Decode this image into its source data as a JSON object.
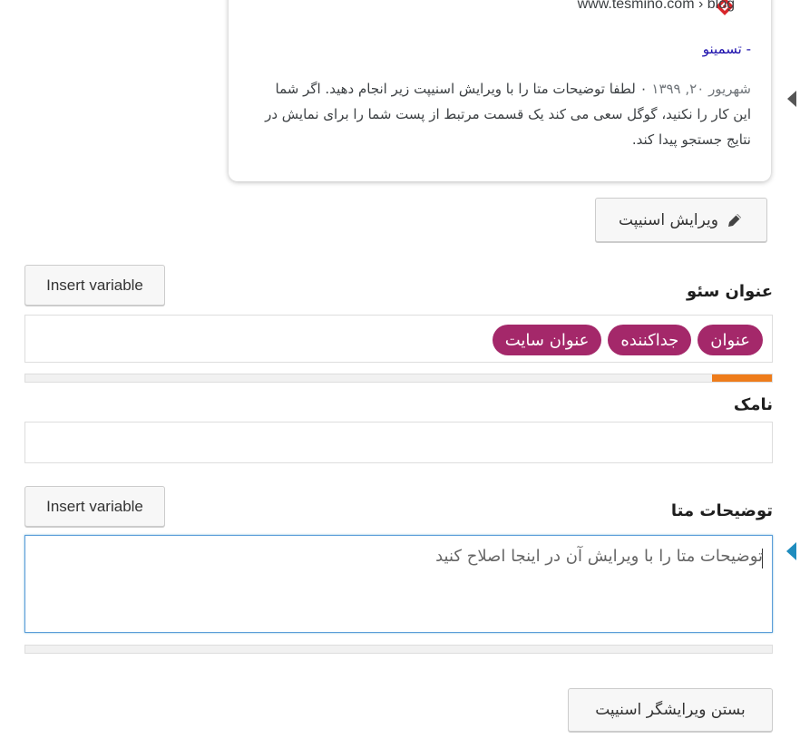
{
  "preview": {
    "url": "www.tesmino.com › blog",
    "site_name": "- تسمینو",
    "date": "شهریور ۲۰, ۱۳۹۹ ",
    "description": "۰ لطفا توضیحات متا را با ویرایش اسنیپت زیر انجام دهید. اگر شما این کار را نکنید، گوگل سعی می کند یک قسمت مرتبط از پست شما را برای نمایش در نتایج جستجو پیدا کند."
  },
  "edit_snippet_button": "ویرایش اسنیپت",
  "seo_title": {
    "label": "عنوان سئو",
    "insert_variable": "Insert variable",
    "pills": [
      "عنوان",
      "جداکننده",
      "عنوان سایت"
    ],
    "progress_percent": 8,
    "progress_color": "#ee7c1b"
  },
  "slug": {
    "label": "نامک",
    "value": ""
  },
  "meta_description": {
    "label": "توضیحات متا",
    "insert_variable": "Insert variable",
    "placeholder": "توضیحات متا را با ویرایش آن در اینجا اصلاح کنید",
    "progress_percent": 0
  },
  "close_editor_button": "بستن ویرایشگر اسنیپت",
  "colors": {
    "pill": "#a4286a",
    "focus_border": "#5b9dd9",
    "link": "#1a0dab"
  }
}
